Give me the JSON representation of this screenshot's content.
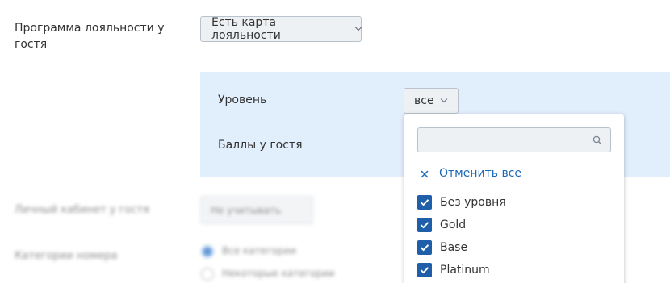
{
  "loyalty": {
    "label": "Программа лояльности у гостя",
    "value": "Есть карта лояльности"
  },
  "panel": {
    "level_label": "Уровень",
    "level_value": "все",
    "points_label": "Баллы у гостя"
  },
  "blurred": {
    "account_label": "Личный кабинет у гостя",
    "account_value": "Не учитывать",
    "room_category_label": "Категории номера",
    "all_categories": "Все категории",
    "some_categories": "Некоторые категории"
  },
  "dropdown": {
    "search_placeholder": "",
    "search_value": "",
    "cancel_all": "Отменить все",
    "options": [
      {
        "label": "Без уровня",
        "checked": true
      },
      {
        "label": "Gold",
        "checked": true
      },
      {
        "label": "Base",
        "checked": true
      },
      {
        "label": "Platinum",
        "checked": true
      }
    ]
  },
  "colors": {
    "panel_bg": "#e1eefb",
    "accent": "#1f5ea8",
    "link": "#1a68b8"
  }
}
